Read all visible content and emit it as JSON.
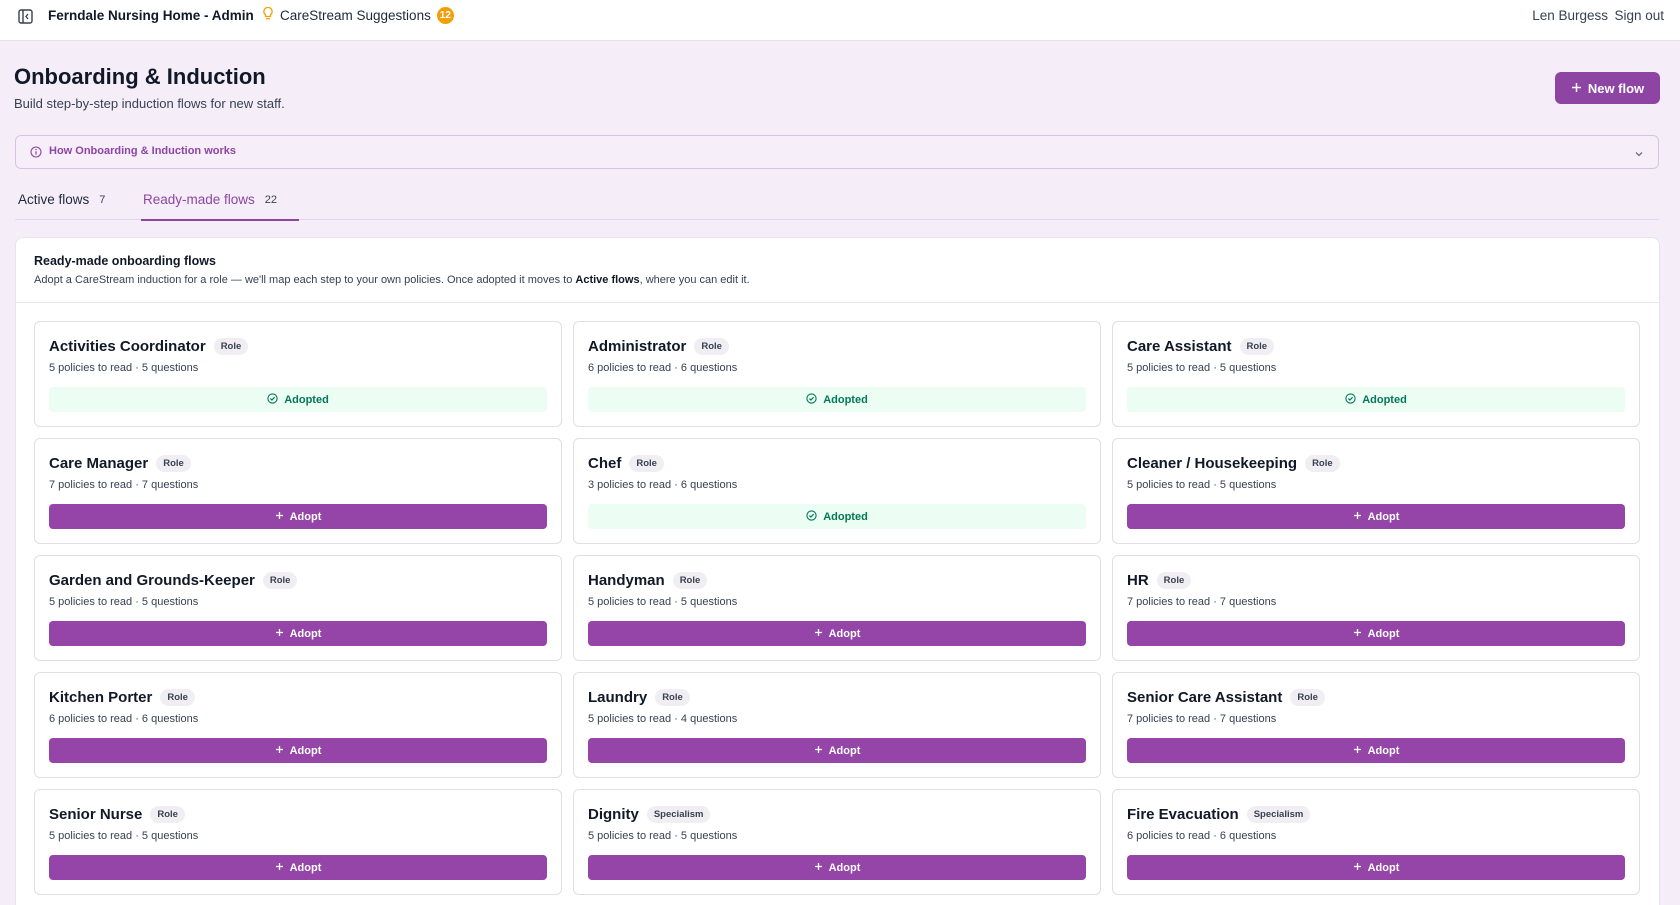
{
  "topbar": {
    "app_title": "Ferndale Nursing Home - Admin",
    "suggestions_label": "CareStream Suggestions",
    "suggestions_count": "12",
    "user_name": "Len Burgess",
    "sign_out": "Sign out"
  },
  "header": {
    "title": "Onboarding & Induction",
    "subtitle": "Build step-by-step induction flows for new staff.",
    "new_flow_label": "New flow"
  },
  "how_it_works": {
    "label": "How Onboarding & Induction works"
  },
  "tabs": [
    {
      "label": "Active flows",
      "count": "7",
      "active": false
    },
    {
      "label": "Ready-made flows",
      "count": "22",
      "active": true
    }
  ],
  "panel": {
    "title": "Ready-made onboarding flows",
    "desc_before": "Adopt a CareStream induction for a role — we'll map each step to your own policies. Once adopted it moves to ",
    "desc_bold": "Active flows",
    "desc_after": ", where you can edit it."
  },
  "cards": [
    {
      "name": "Activities Coordinator",
      "tag": "Role",
      "meta": "5 policies to read · 5 questions",
      "status": "adopted",
      "action_label": "Adopted"
    },
    {
      "name": "Administrator",
      "tag": "Role",
      "meta": "6 policies to read · 6 questions",
      "status": "adopted",
      "action_label": "Adopted"
    },
    {
      "name": "Care Assistant",
      "tag": "Role",
      "meta": "5 policies to read · 5 questions",
      "status": "adopted",
      "action_label": "Adopted"
    },
    {
      "name": "Care Manager",
      "tag": "Role",
      "meta": "7 policies to read · 7 questions",
      "status": "adopt",
      "action_label": "Adopt"
    },
    {
      "name": "Chef",
      "tag": "Role",
      "meta": "3 policies to read · 6 questions",
      "status": "adopted",
      "action_label": "Adopted"
    },
    {
      "name": "Cleaner / Housekeeping",
      "tag": "Role",
      "meta": "5 policies to read · 5 questions",
      "status": "adopt",
      "action_label": "Adopt"
    },
    {
      "name": "Garden and Grounds-Keeper",
      "tag": "Role",
      "meta": "5 policies to read · 5 questions",
      "status": "adopt",
      "action_label": "Adopt"
    },
    {
      "name": "Handyman",
      "tag": "Role",
      "meta": "5 policies to read · 5 questions",
      "status": "adopt",
      "action_label": "Adopt"
    },
    {
      "name": "HR",
      "tag": "Role",
      "meta": "7 policies to read · 7 questions",
      "status": "adopt",
      "action_label": "Adopt"
    },
    {
      "name": "Kitchen Porter",
      "tag": "Role",
      "meta": "6 policies to read · 6 questions",
      "status": "adopt",
      "action_label": "Adopt"
    },
    {
      "name": "Laundry",
      "tag": "Role",
      "meta": "5 policies to read · 4 questions",
      "status": "adopt",
      "action_label": "Adopt"
    },
    {
      "name": "Senior Care Assistant",
      "tag": "Role",
      "meta": "7 policies to read · 7 questions",
      "status": "adopt",
      "action_label": "Adopt"
    },
    {
      "name": "Senior Nurse",
      "tag": "Role",
      "meta": "5 policies to read · 5 questions",
      "status": "adopt",
      "action_label": "Adopt"
    },
    {
      "name": "Dignity",
      "tag": "Specialism",
      "meta": "5 policies to read · 5 questions",
      "status": "adopt",
      "action_label": "Adopt"
    },
    {
      "name": "Fire Evacuation",
      "tag": "Specialism",
      "meta": "6 policies to read · 6 questions",
      "status": "adopt",
      "action_label": "Adopt"
    }
  ],
  "colors": {
    "accent": "#8e44a3",
    "adopted_bg": "#ecfdf3",
    "adopted_text": "#047857",
    "badge": "#f59e0b"
  }
}
